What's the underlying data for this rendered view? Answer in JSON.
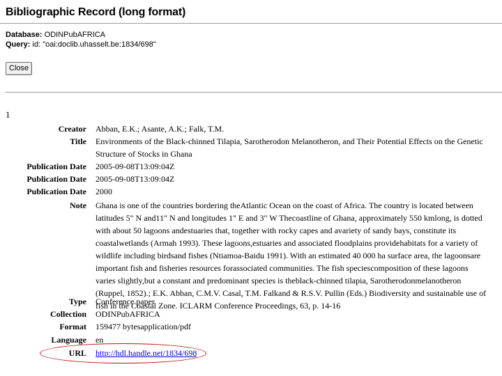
{
  "page": {
    "title": "Bibliographic Record (long format)",
    "database_label": "Database:",
    "database_value": "ODINPubAFRICA",
    "query_label": "Query:",
    "query_value": "id: \"oai:doclib.uhasselt.be:1834/698\"",
    "close_label": "Close",
    "record_number": "1"
  },
  "fields": [
    {
      "label": "Creator",
      "value": "Abban, E.K.; Asante, A.K.; Falk, T.M."
    },
    {
      "label": "Title",
      "value": "Environments of the Black-chinned Tilapia, Sarotherodon Melanotheron, and Their Potential Effects on the Genetic Structure of Stocks in Ghana"
    },
    {
      "label": "Publication Date",
      "value": "2005-09-08T13:09:04Z"
    },
    {
      "label": "Publication Date",
      "value": "2005-09-08T13:09:04Z"
    },
    {
      "label": "Publication Date",
      "value": "2000"
    },
    {
      "label": "Note",
      "value": "Ghana is one of the countries bordering theAtlantic Ocean on the coast of Africa. The country is located between latitudes 5\" N and11\" N and longitudes 1\" E and 3\" W Thecoastline of Ghana, approximately 550 kmlong, is dotted with about 50 lagoons andestuaries that, together with rocky capes and avariety of sandy bays, constitute its coastalwetlands (Armah 1993). These lagoons,estuaries and associated floodplains providehabitats for a variety of wildlife including birdsand fishes (Ntiamoa-Baidu 1991). With an estimated 40 000 ha surface area, the lagoonsare important fish and fisheries resources forassociated communities. The fish speciescomposition of these lagoons varies slightly,but a constant and predominant species is theblack-chinned tilapia, Sarotherodonmelanotheron (Ruppel, 1852).; E.K. Abban, C.M.V. Casal, T.M. Falkand & R.S.V. Pullin (Eds.) Biodiversity and sustainable use of fish in the Coastal Zone. ICLARM Conference Proceedings, 63, p. 14-16"
    },
    {
      "label": "Type",
      "value": "Conference paper"
    },
    {
      "label": "Collection",
      "value": "ODINPubAFRICA"
    },
    {
      "label": "Format",
      "value": "159477 bytesapplication/pdf"
    },
    {
      "label": "Language",
      "value": "en"
    },
    {
      "label": "URL",
      "value": "http://hdl.handle.net/1834/698"
    }
  ],
  "colors": {
    "link": "#0000cc",
    "annotation_oval": "#c01010",
    "rule": "#9a9a9a"
  }
}
